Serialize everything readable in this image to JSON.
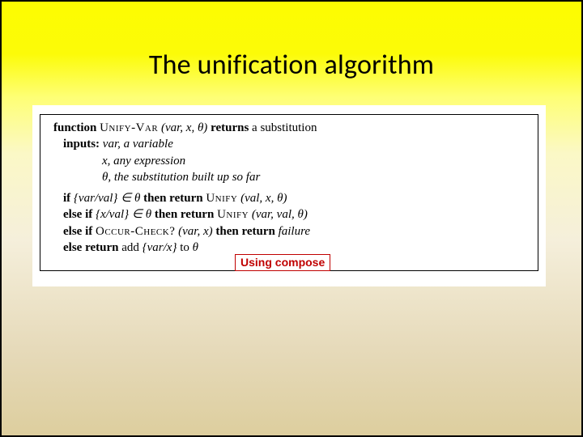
{
  "title": "The unification algorithm",
  "algo": {
    "l1_kw1": "function",
    "l1_fn": "Unify-Var",
    "l1_args": "(var, x, θ)",
    "l1_kw2": "returns",
    "l1_rest": "a substitution",
    "l2_kw": "inputs:",
    "l2_rest": "var, a variable",
    "l3": "x, any expression",
    "l4": "θ, the substitution built up so far",
    "l5_kw1": "if",
    "l5_mid": "{var/val}  ∈  θ",
    "l5_kw2": "then return",
    "l5_fn": "Unify",
    "l5_args": "(val, x, θ)",
    "l6_kw1": "else if",
    "l6_mid": "{x/val}  ∈  θ",
    "l6_kw2": "then return",
    "l6_fn": "Unify",
    "l6_args": "(var, val, θ)",
    "l7_kw1": "else if",
    "l7_fn": "Occur-Check?",
    "l7_args": "(var, x)",
    "l7_kw2": "then return",
    "l7_rest": "failure",
    "l8_kw1": "else return",
    "l8_mid1": "add",
    "l8_mid2": "{var/x}",
    "l8_mid3": "to",
    "l8_rest": "θ"
  },
  "annotation": "Using compose"
}
